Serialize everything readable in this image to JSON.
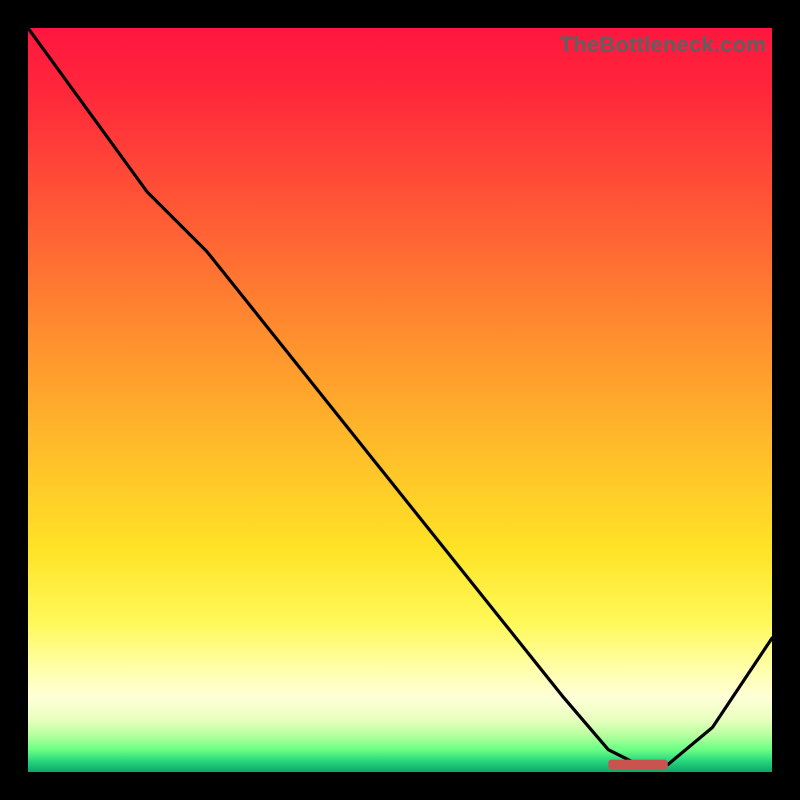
{
  "watermark": "TheBottleneck.com",
  "chart_data": {
    "type": "line",
    "title": "",
    "xlabel": "",
    "ylabel": "",
    "xlim": [
      0,
      100
    ],
    "ylim": [
      0,
      100
    ],
    "series": [
      {
        "name": "curve",
        "x": [
          0,
          8,
          16,
          24,
          32,
          40,
          48,
          56,
          64,
          72,
          78,
          82,
          86,
          92,
          100
        ],
        "y": [
          100,
          89,
          78,
          70,
          60,
          50,
          40,
          30,
          20,
          10,
          3,
          1,
          1,
          6,
          18
        ]
      }
    ],
    "minimum_marker": {
      "x_start": 78,
      "x_end": 86,
      "y": 1
    }
  },
  "gradient_stops": [
    {
      "pos": 0.0,
      "color": "#ff163f"
    },
    {
      "pos": 0.1,
      "color": "#ff2b3a"
    },
    {
      "pos": 0.25,
      "color": "#ff5a35"
    },
    {
      "pos": 0.4,
      "color": "#ff8a2f"
    },
    {
      "pos": 0.55,
      "color": "#ffb82a"
    },
    {
      "pos": 0.7,
      "color": "#ffe326"
    },
    {
      "pos": 0.8,
      "color": "#fff95a"
    },
    {
      "pos": 0.86,
      "color": "#ffffa8"
    },
    {
      "pos": 0.9,
      "color": "#ffffd8"
    },
    {
      "pos": 0.93,
      "color": "#e8ffbf"
    },
    {
      "pos": 0.95,
      "color": "#b8ff9e"
    },
    {
      "pos": 0.97,
      "color": "#6aff85"
    },
    {
      "pos": 0.985,
      "color": "#29d77d"
    },
    {
      "pos": 1.0,
      "color": "#0aa768"
    }
  ]
}
